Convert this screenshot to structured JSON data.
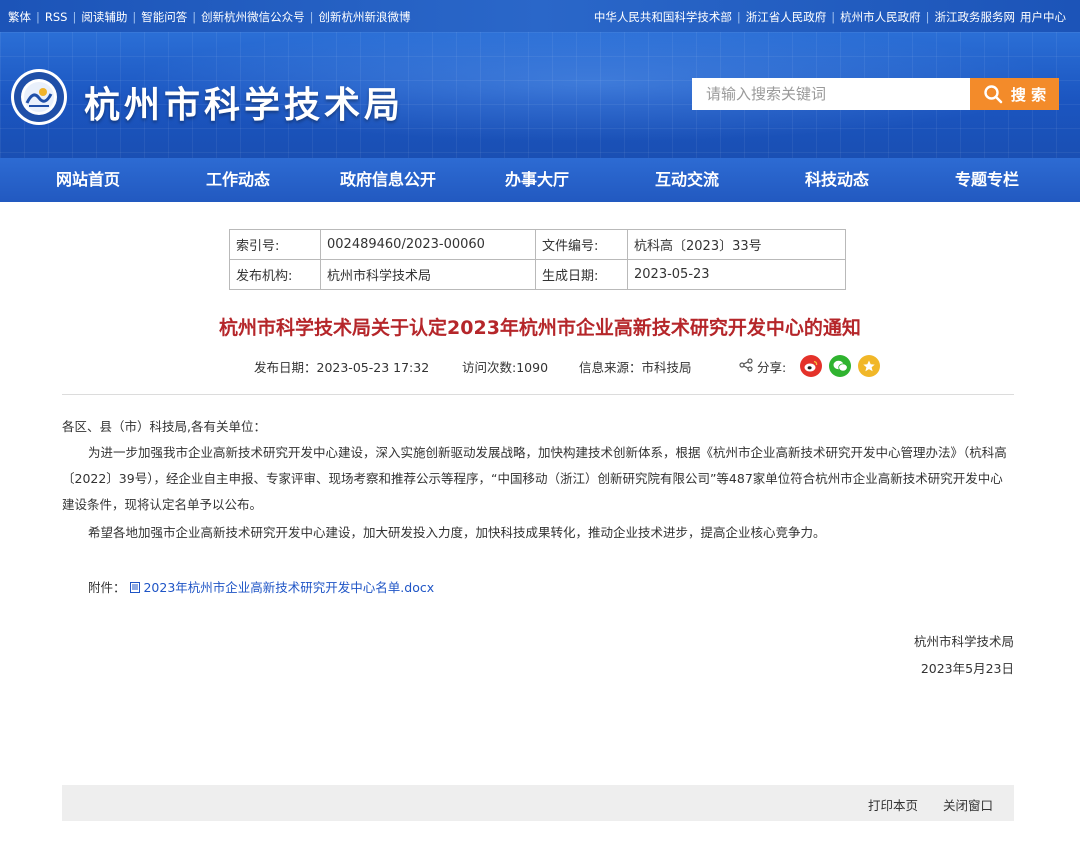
{
  "topbar": {
    "left_links": [
      "繁体",
      "RSS",
      "阅读辅助",
      "智能问答",
      "创新杭州微信公众号",
      "创新杭州新浪微博"
    ],
    "right_links": [
      "中华人民共和国科学技术部",
      "浙江省人民政府",
      "杭州市人民政府",
      "浙江政务服务网",
      "用户中心"
    ]
  },
  "header": {
    "site_title": "杭州市科学技术局",
    "search_placeholder": "请输入搜索关键词",
    "search_button": "搜 索"
  },
  "nav": {
    "items": [
      "网站首页",
      "工作动态",
      "政府信息公开",
      "办事大厅",
      "互动交流",
      "科技动态",
      "专题专栏"
    ]
  },
  "info": {
    "index_label": "索引号:",
    "index_value": "002489460/2023-00060",
    "doc_no_label": "文件编号:",
    "doc_no_value": "杭科高〔2023〕33号",
    "publisher_label": "发布机构:",
    "publisher_value": "杭州市科学技术局",
    "date_label": "生成日期:",
    "date_value": "2023-05-23"
  },
  "article": {
    "title": "杭州市科学技术局关于认定2023年杭州市企业高新技术研究开发中心的通知",
    "publish_date": "发布日期：2023-05-23 17:32",
    "visits": "访问次数:1090",
    "source": "信息来源：市科技局",
    "share_label": "分享:",
    "salutation": "各区、县（市）科技局,各有关单位：",
    "para1": "为进一步加强我市企业高新技术研究开发中心建设，深入实施创新驱动发展战略，加快构建技术创新体系，根据《杭州市企业高新技术研究开发中心管理办法》（杭科高〔2022〕39号），经企业自主申报、专家评审、现场考察和推荐公示等程序，“中国移动（浙江）创新研究院有限公司”等487家单位符合杭州市企业高新技术研究开发中心建设条件，现将认定名单予以公布。",
    "para2": "希望各地加强市企业高新技术研究开发中心建设，加大研发投入力度，加快科技成果转化，推动企业技术进步，提高企业核心竞争力。",
    "attachment_label": "附件：",
    "attachment_file": "2023年杭州市企业高新技术研究开发中心名单.docx",
    "sign_org": "杭州市科学技术局",
    "sign_date": "2023年5月23日"
  },
  "footer": {
    "print": "打印本页",
    "close": "关闭窗口"
  }
}
